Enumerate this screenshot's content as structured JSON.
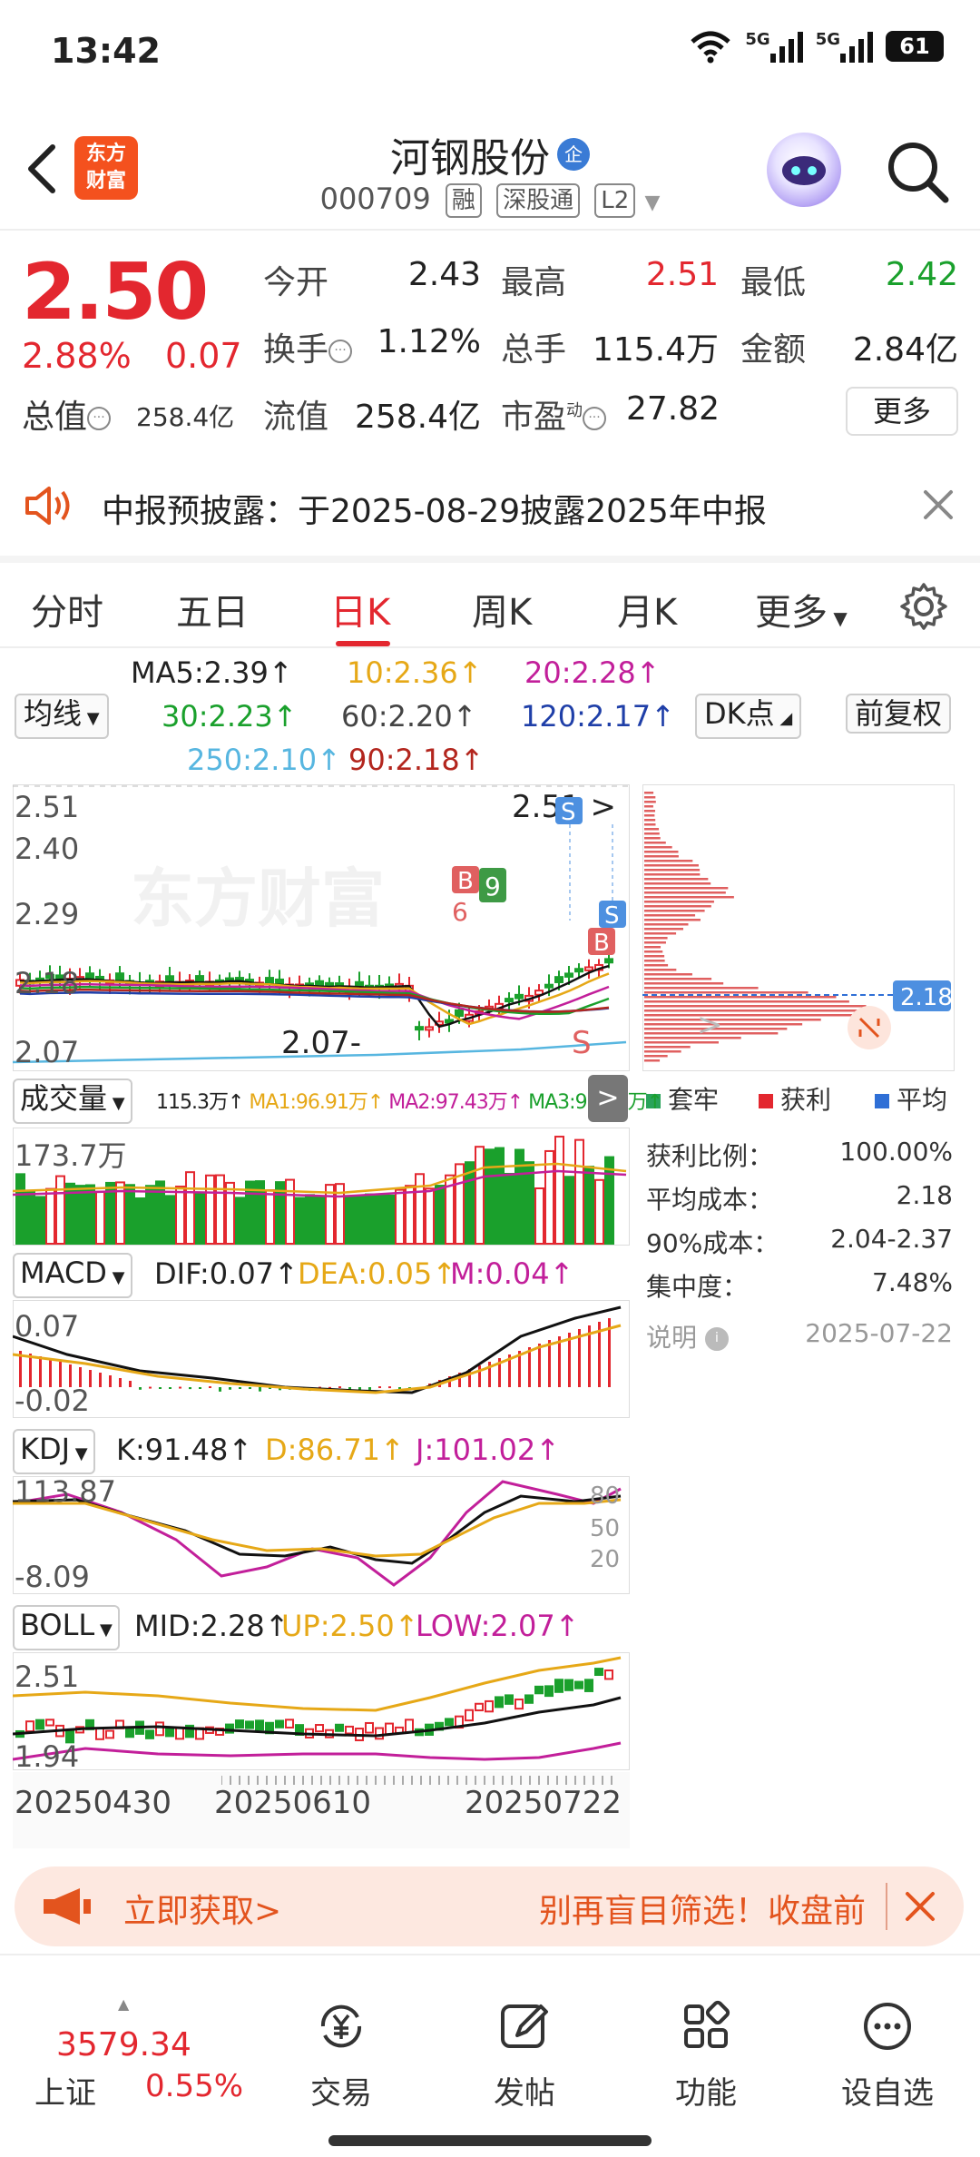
{
  "status_bar": {
    "time": "13:42",
    "network1": "5G",
    "network2": "5G",
    "battery": "61"
  },
  "header": {
    "logo_line1": "东方",
    "logo_line2": "财富",
    "stock_name": "河钢股份",
    "badge": "企",
    "code": "000709",
    "tags": [
      "融",
      "深股通",
      "L2"
    ]
  },
  "quote": {
    "price": "2.50",
    "change_pct": "2.88%",
    "change": "0.07",
    "fields": [
      {
        "label": "今开",
        "value": "2.43",
        "color": "#222"
      },
      {
        "label": "最高",
        "value": "2.51",
        "color": "#e3272f"
      },
      {
        "label": "最低",
        "value": "2.42",
        "color": "#1aa02c"
      },
      {
        "label": "换手",
        "value": "1.12%",
        "color": "#222"
      },
      {
        "label": "总手",
        "value": "115.4万",
        "color": "#222"
      },
      {
        "label": "金额",
        "value": "2.84亿",
        "color": "#222"
      },
      {
        "label": "流值",
        "value": "258.4亿",
        "color": "#222"
      },
      {
        "label": "市盈",
        "value": "27.82",
        "color": "#222"
      }
    ],
    "market_cap_label": "总值",
    "market_cap": "258.4亿",
    "pe_superscript": "动",
    "more_label": "更多"
  },
  "notice": {
    "text": "中报预披露：于2025-08-29披露2025年中报"
  },
  "tabs": [
    "分时",
    "五日",
    "日K",
    "周K",
    "月K",
    "更多"
  ],
  "active_tab": "日K",
  "ma_legend": {
    "selector": "均线",
    "ma5": "MA5:2.39↑",
    "ma10": "10:2.36↑",
    "ma20": "20:2.28↑",
    "ma30": "30:2.23↑",
    "ma60": "60:2.20↑",
    "ma120": "120:2.17↑",
    "ma250": "250:2.10↑",
    "ma90": "90:2.18↑",
    "dk_label": "DK点",
    "adjust_label": "前复权"
  },
  "kline": {
    "axis_labels": [
      "2.51",
      "2.40",
      "2.29",
      "2.18",
      "2.07"
    ],
    "high_label": "2.51",
    "low_label": "2.07",
    "watermark": "东方财富",
    "signals": [
      "S",
      "S",
      "B",
      "B",
      "9",
      "6",
      "S"
    ]
  },
  "volume": {
    "selector": "成交量",
    "vol": "115.3万↑",
    "ma1": "MA1:96.91万↑",
    "ma2": "MA2:97.43万↑",
    "ma3": "MA3:98.09万↑",
    "axis_top": "173.7万"
  },
  "macd": {
    "selector": "MACD",
    "dif": "DIF:0.07↑",
    "dea": "DEA:0.05↑",
    "m": "M:0.04↑",
    "axis_top": "0.07",
    "axis_bottom": "-0.02"
  },
  "kdj": {
    "selector": "KDJ",
    "k": "K:91.48↑",
    "d": "D:86.71↑",
    "j": "J:101.02↑",
    "axis_top": "113.87",
    "axis_bottom": "-8.09",
    "levels": [
      "80",
      "50",
      "20"
    ]
  },
  "boll": {
    "selector": "BOLL",
    "mid": "MID:2.28↑",
    "up": "UP:2.50↑",
    "low": "LOW:2.07↑",
    "axis_top": "2.51",
    "axis_bottom": "1.94"
  },
  "dates": [
    "20250430",
    "20250610",
    "20250722"
  ],
  "chips": {
    "avg_label": "2.18",
    "legend": [
      {
        "label": "套牢",
        "color": "#2aa35a"
      },
      {
        "label": "获利",
        "color": "#e3272f"
      },
      {
        "label": "平均",
        "color": "#2f6fd6"
      }
    ],
    "stats": [
      {
        "label": "获利比例：",
        "value": "100.00%"
      },
      {
        "label": "平均成本：",
        "value": "2.18"
      },
      {
        "label": "90%成本：",
        "value": "2.04-2.37"
      },
      {
        "label": "集中度：",
        "value": "7.48%"
      }
    ],
    "note_label": "说明",
    "note_date": "2025-07-22"
  },
  "promo": {
    "cta": "立即获取>",
    "text": "别再盲目筛选！收盘前"
  },
  "bottom_bar": {
    "index_value": "3579.34",
    "index_name": "上证",
    "index_pct": "0.55%",
    "items": [
      "交易",
      "发帖",
      "功能",
      "设自选"
    ]
  }
}
